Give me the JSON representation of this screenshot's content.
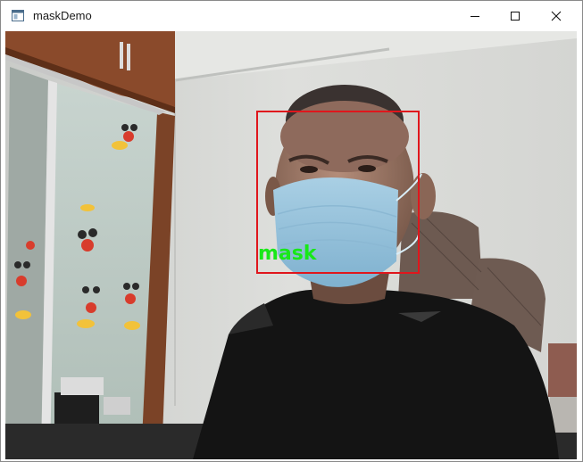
{
  "window": {
    "title": "maskDemo",
    "controls": {
      "minimize_icon": "minimize-icon",
      "maximize_icon": "maximize-icon",
      "close_icon": "close-icon"
    }
  },
  "detection": {
    "label": "mask",
    "box_color": "#e0161c",
    "label_color": "#18e818"
  }
}
